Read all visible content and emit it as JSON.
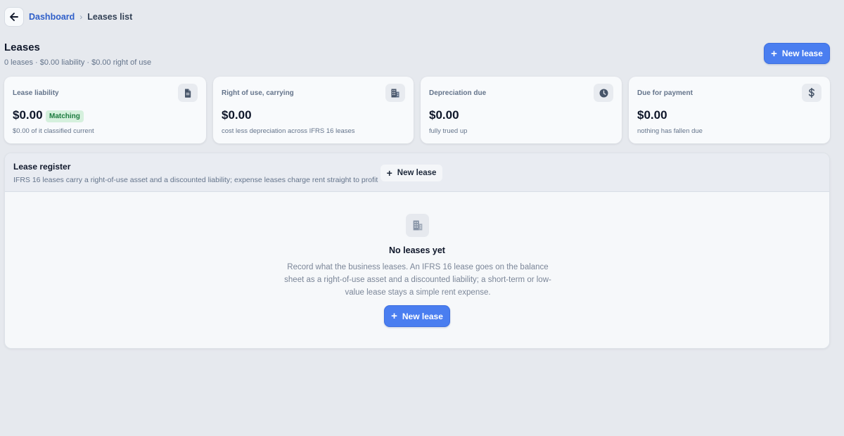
{
  "breadcrumb": {
    "back_icon": "arrow-left-icon",
    "parent": "Dashboard",
    "separator": "›",
    "current": "Leases list"
  },
  "header": {
    "title": "Leases",
    "summary": "0 leases · $0.00 liability · $0.00 right of use",
    "new_lease_label": "New lease"
  },
  "cards": [
    {
      "label": "Lease liability",
      "value": "$0.00",
      "badge": "Matching",
      "sub": "$0.00 of it classified current",
      "icon": "document-icon"
    },
    {
      "label": "Right of use, carrying",
      "value": "$0.00",
      "sub": "cost less depreciation across IFRS 16 leases",
      "icon": "building-icon"
    },
    {
      "label": "Depreciation due",
      "value": "$0.00",
      "sub": "fully trued up",
      "icon": "clock-icon"
    },
    {
      "label": "Due for payment",
      "value": "$0.00",
      "sub": "nothing has fallen due",
      "icon": "dollar-icon"
    }
  ],
  "register": {
    "title": "Lease register",
    "description": "IFRS 16 leases carry a right-of-use asset and a discounted liability; expense leases charge rent straight to profit",
    "new_lease_label": "New lease",
    "empty": {
      "icon": "building-icon",
      "title": "No leases yet",
      "description": "Record what the business leases. An IFRS 16 lease goes on the balance sheet as a right-of-use asset and a discounted liability; a short-term or low-value lease stays a simple rent expense.",
      "button_label": "New lease"
    }
  },
  "colors": {
    "accent": "#4a7ef0",
    "link": "#2f5fc9",
    "badge_bg": "#d5f0dd",
    "badge_text": "#1b7a3e",
    "background": "#e6e9ee"
  }
}
